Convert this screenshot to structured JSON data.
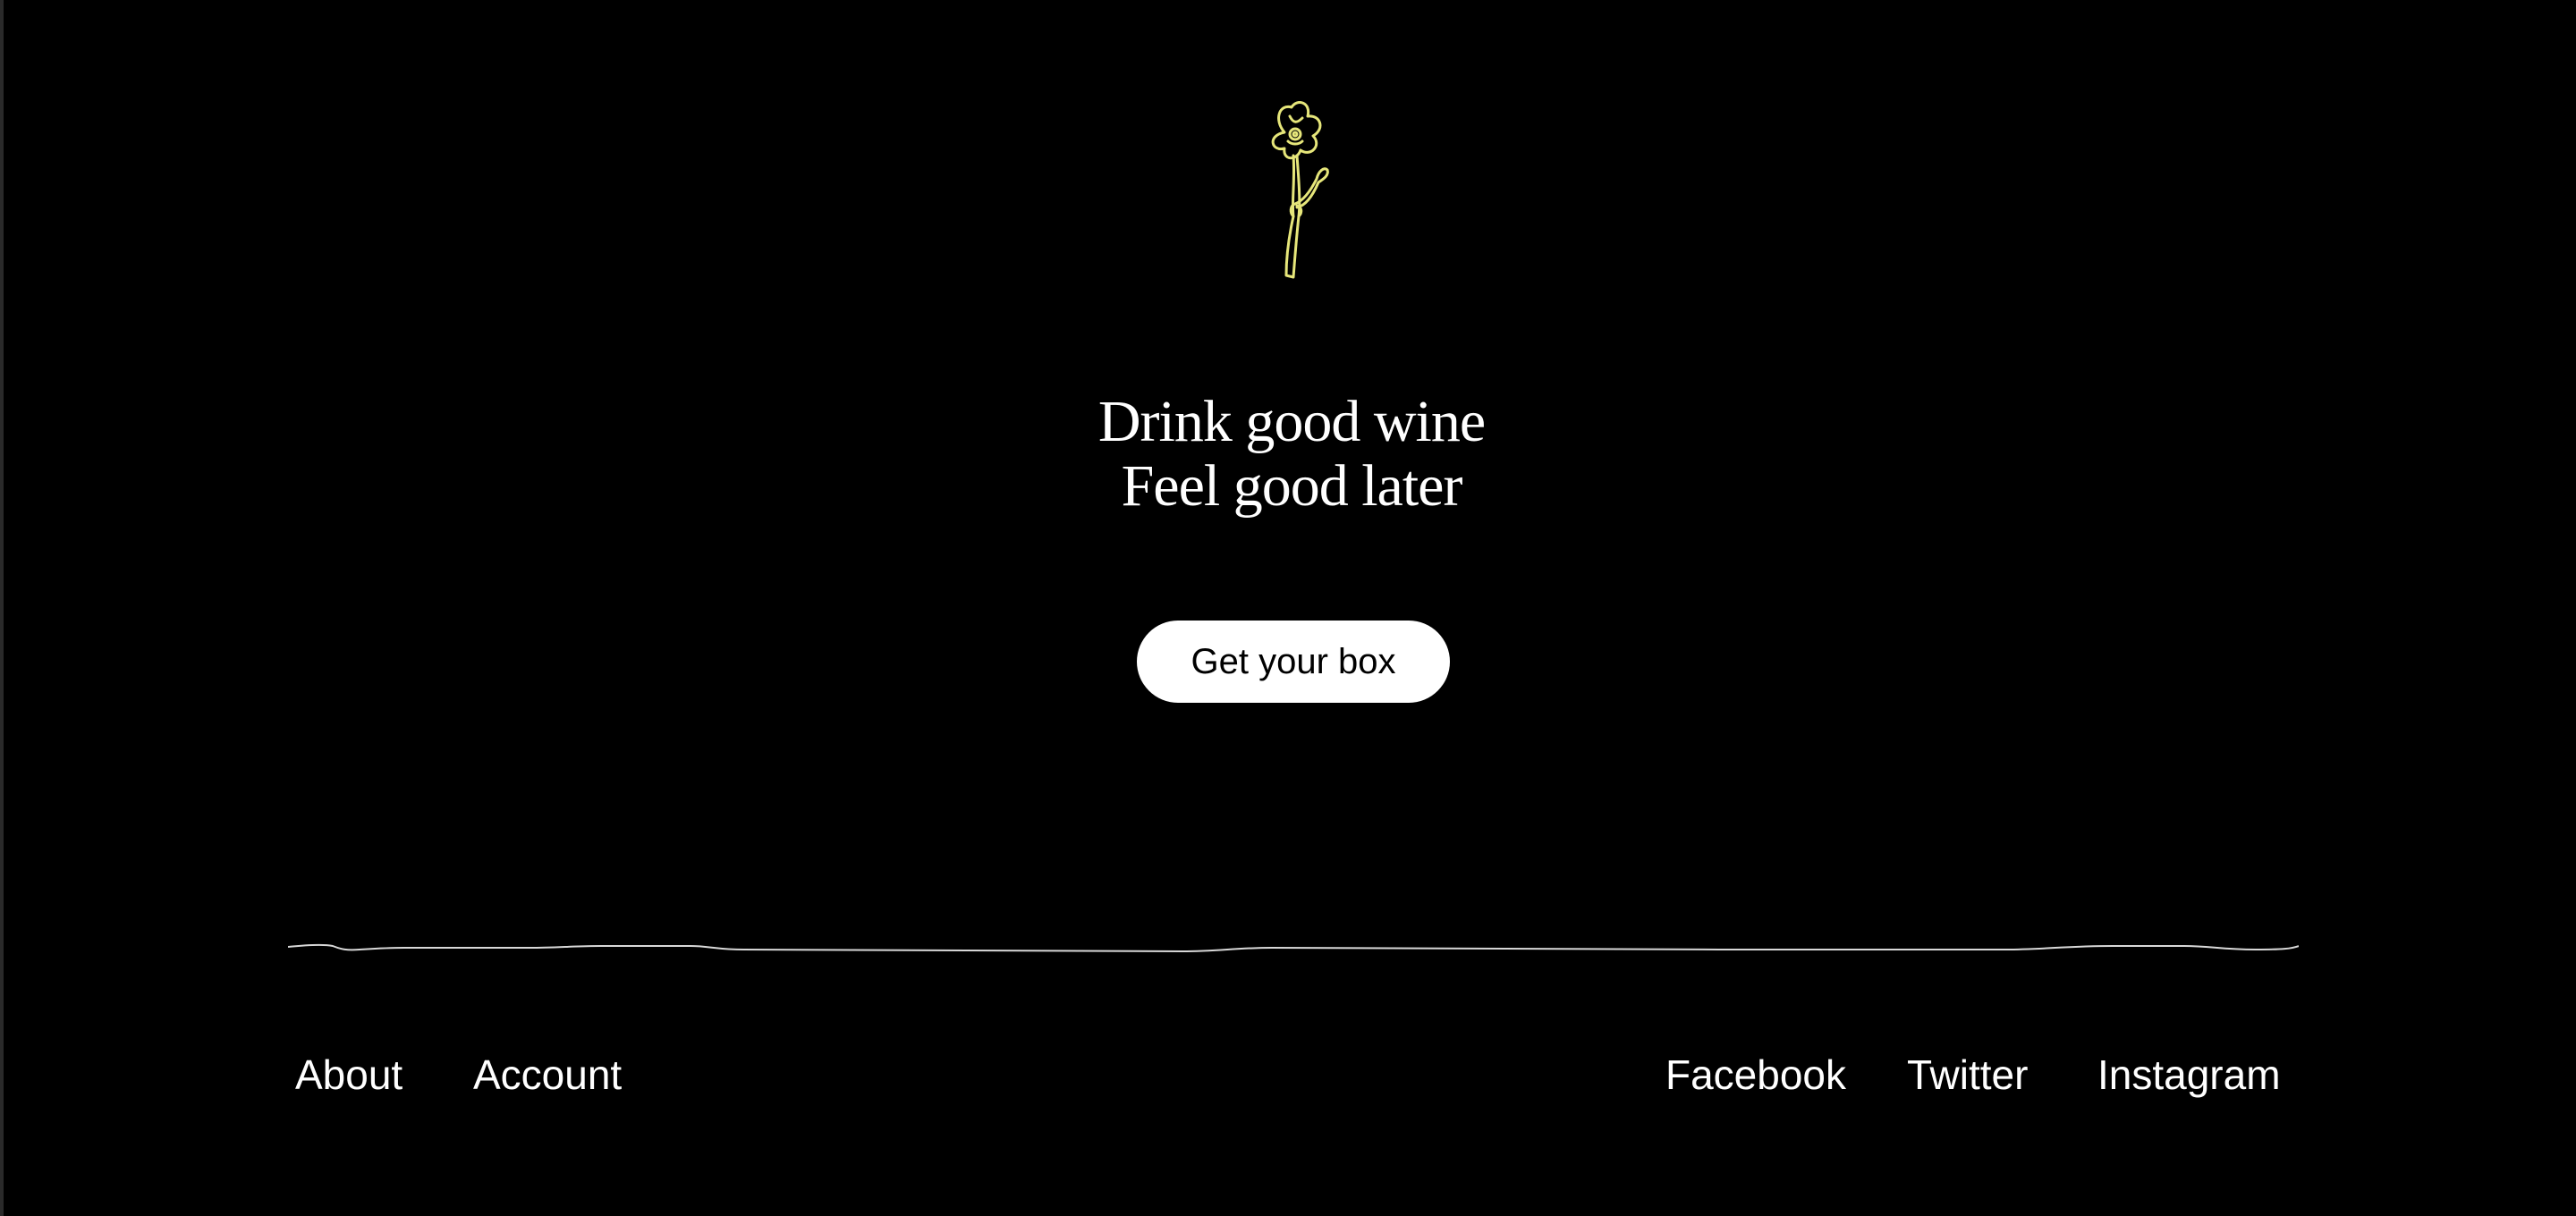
{
  "hero": {
    "headline_line1": "Drink good wine",
    "headline_line2": "Feel good later",
    "icon": "flower-icon",
    "icon_color": "#e6e67a"
  },
  "cta": {
    "label": "Get your box"
  },
  "footer": {
    "left_links": [
      {
        "label": "About"
      },
      {
        "label": "Account"
      }
    ],
    "right_links": [
      {
        "label": "Facebook"
      },
      {
        "label": "Twitter"
      },
      {
        "label": "Instagram"
      }
    ]
  },
  "colors": {
    "background": "#000000",
    "text": "#ffffff",
    "accent": "#e6e67a",
    "button_bg": "#ffffff",
    "button_text": "#000000"
  }
}
